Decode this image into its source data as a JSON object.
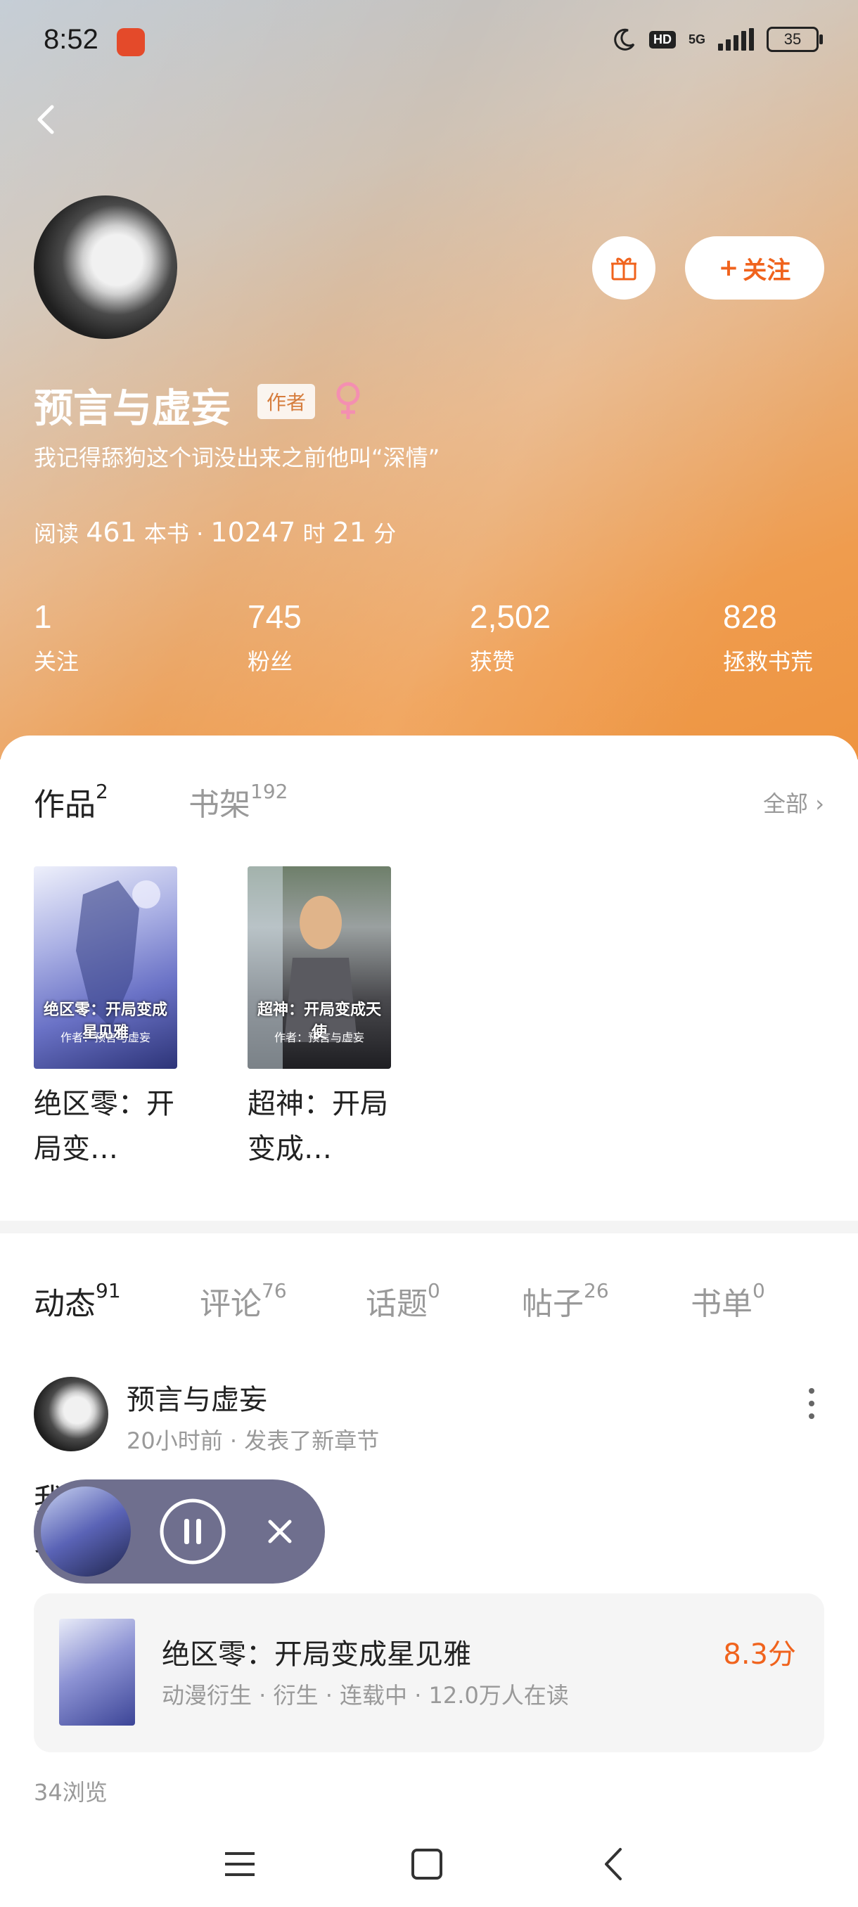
{
  "status_bar": {
    "time": "8:52",
    "network": "5G",
    "hd": "HD",
    "battery": "35"
  },
  "profile": {
    "name": "预言与虚妄",
    "badge": "作者",
    "signature": "我记得舔狗这个词没出来之前他叫“深情”",
    "reading": {
      "prefix": "阅读",
      "books": "461",
      "books_unit": "本书 ·",
      "hours": "10247",
      "hours_unit": "时",
      "minutes": "21",
      "minutes_unit": "分"
    },
    "follow_label": "关注"
  },
  "stats": [
    {
      "value": "1",
      "label": "关注"
    },
    {
      "value": "745",
      "label": "粉丝"
    },
    {
      "value": "2,502",
      "label": "获赞"
    },
    {
      "value": "828",
      "label": "拯救书荒"
    }
  ],
  "works_tabs": [
    {
      "label": "作品",
      "count": "2"
    },
    {
      "label": "书架",
      "count": "192"
    }
  ],
  "all_label": "全部",
  "books": [
    {
      "title": "绝区零：开局变…",
      "cover_title": "绝区零：开局变成星见雅",
      "cover_author": "作者：预言与虚妄"
    },
    {
      "title": "超神：开局变成…",
      "cover_title": "超神：开局变成天使",
      "cover_author": "作者：预言与虚妄"
    }
  ],
  "activity_tabs": [
    {
      "label": "动态",
      "count": "91"
    },
    {
      "label": "评论",
      "count": "76"
    },
    {
      "label": "话题",
      "count": "0"
    },
    {
      "label": "帖子",
      "count": "26"
    },
    {
      "label": "书单",
      "count": "0"
    }
  ],
  "post": {
    "author": "预言与虚妄",
    "meta": "20小时前 · 发表了新章节",
    "text": "我\n更",
    "book": {
      "title": "绝区零：开局变成星见雅",
      "subtitle": "动漫衍生 · 衍生 · 连载中 · 12.0万人在读",
      "score": "8.3分"
    },
    "views": "34浏览"
  },
  "colors": {
    "accent": "#f0631d",
    "player_bg": "#6f6f8e"
  }
}
